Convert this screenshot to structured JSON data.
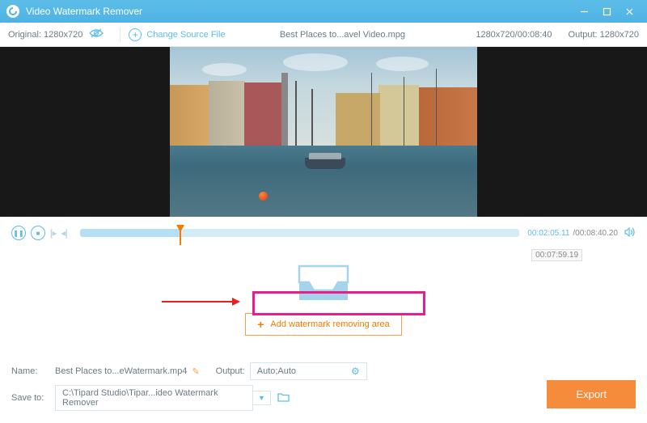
{
  "titlebar": {
    "title": "Video Watermark Remover"
  },
  "toolbar": {
    "original": "Original: 1280x720",
    "change_label": "Change Source File",
    "filename": "Best Places to...avel Video.mpg",
    "dims_time": "1280x720/00:08:40",
    "output": "Output: 1280x720"
  },
  "controls": {
    "current": "00:02:05.11",
    "total": "/00:08:40.20"
  },
  "dropzone": {
    "timestamp": "00:07:59.19",
    "add_label": "Add watermark removing area"
  },
  "bottom": {
    "name_lbl": "Name:",
    "name_val": "Best Places to...eWatermark.mp4",
    "output_lbl": "Output:",
    "output_val": "Auto;Auto",
    "save_lbl": "Save to:",
    "save_val": "C:\\Tipard Studio\\Tipar...ideo Watermark Remover",
    "export": "Export"
  }
}
